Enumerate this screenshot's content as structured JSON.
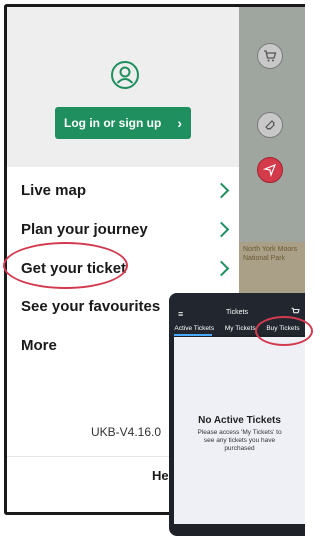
{
  "drawer": {
    "login_button": "Log in or sign up",
    "menu": [
      {
        "label": "Live map"
      },
      {
        "label": "Plan your journey"
      },
      {
        "label": "Get your ticket"
      },
      {
        "label": "See your favourites"
      },
      {
        "label": "More"
      }
    ],
    "version": "UKB-V4.16.0",
    "help_partial": "Hel"
  },
  "map": {
    "label": "North York Moors National Park"
  },
  "tickets_screen": {
    "title": "Tickets",
    "tabs": [
      "Active Tickets",
      "My Tickets",
      "Buy Tickets"
    ],
    "empty_title": "No Active Tickets",
    "empty_desc": "Please access 'My Tickets' to see any tickets you have purchased"
  },
  "colors": {
    "accent_green": "#1f8f5f",
    "highlight_red": "#d43a4f",
    "tab_active": "#4aa8ff"
  },
  "icons": [
    "avatar-icon",
    "chevron-right-icon",
    "cart-icon",
    "ticket-icon",
    "navigate-arrow-icon",
    "hamburger-icon"
  ]
}
